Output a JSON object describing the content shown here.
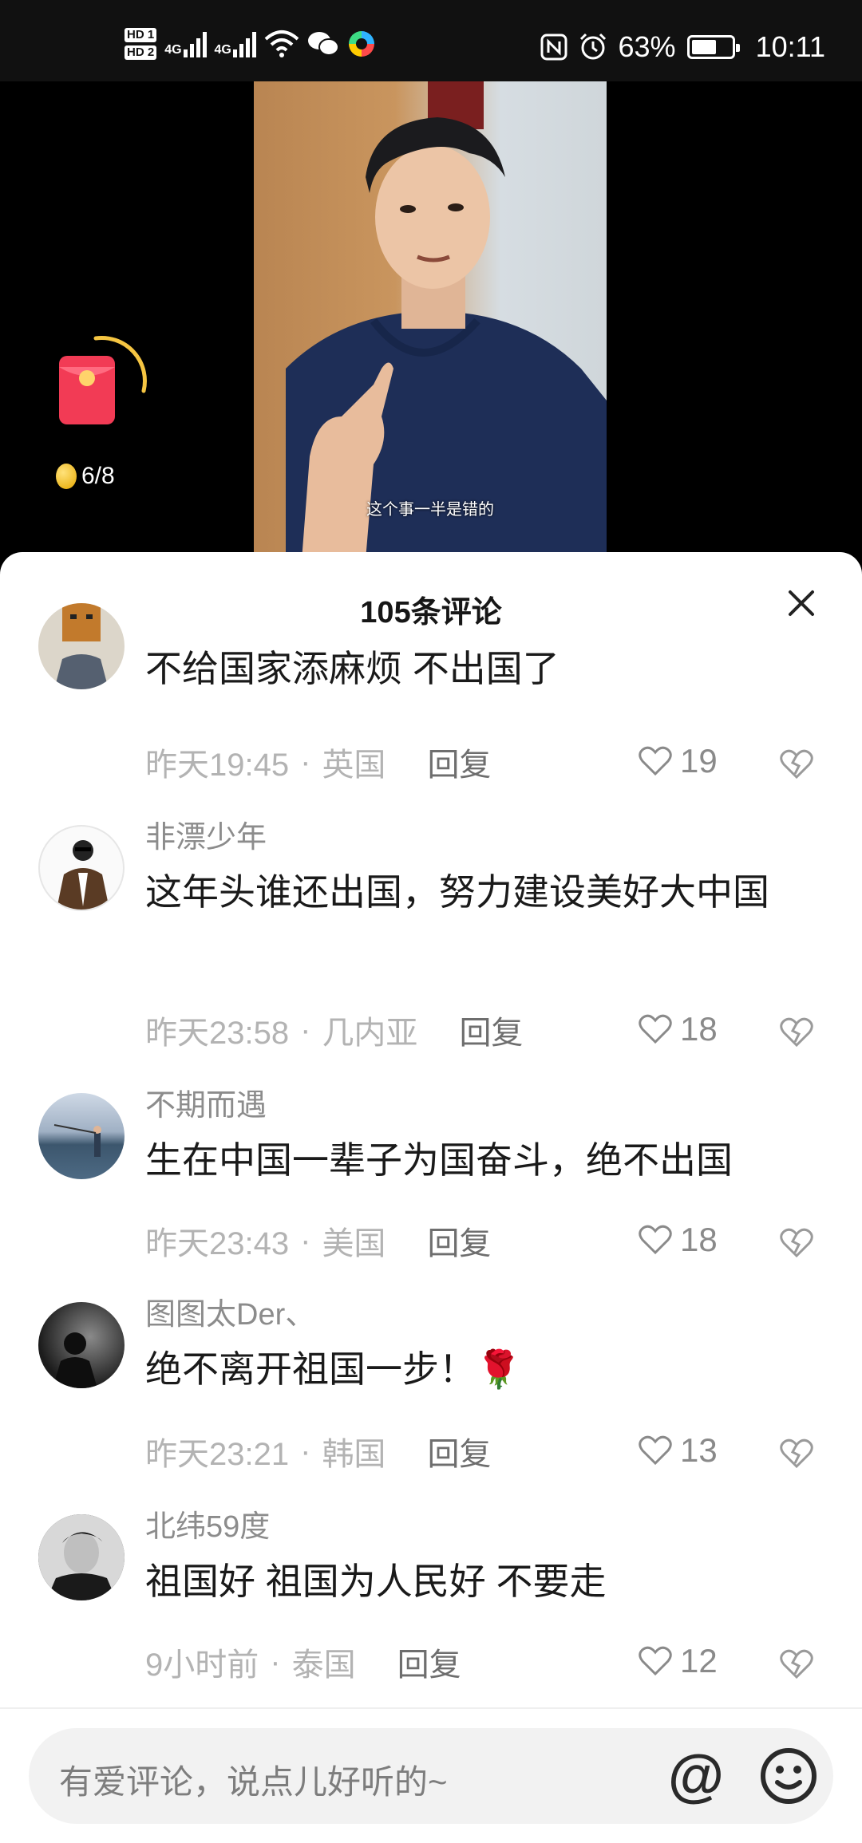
{
  "status_bar": {
    "hd1": "HD 1",
    "hd2": "HD 2",
    "net1": "4G",
    "net2": "4G",
    "battery_percent": "63%",
    "battery_level": 0.63,
    "time": "10:11"
  },
  "video": {
    "subtitle": "这个事一半是错的",
    "coin_progress": "6/8"
  },
  "comments_panel": {
    "title": "105条评论",
    "comments": [
      {
        "username": "",
        "text": "不给国家添麻烦 不出国了",
        "time": "昨天19:45",
        "location": "英国",
        "reply_label": "回复",
        "likes": "19"
      },
      {
        "username": "非漂少年",
        "text": "这年头谁还出国，努力建设美好大中国",
        "time": "昨天23:58",
        "location": "几内亚",
        "reply_label": "回复",
        "likes": "18"
      },
      {
        "username": "不期而遇",
        "text": "生在中国一辈子为国奋斗，绝不出国",
        "time": "昨天23:43",
        "location": "美国",
        "reply_label": "回复",
        "likes": "18"
      },
      {
        "username": "图图太Der、",
        "text": "绝不离开祖国一步！🌹",
        "time": "昨天23:21",
        "location": "韩国",
        "reply_label": "回复",
        "likes": "13"
      },
      {
        "username": "北纬59度",
        "text": "祖国好 祖国为人民好 不要走",
        "time": "9小时前",
        "location": "泰国",
        "reply_label": "回复",
        "likes": "12"
      }
    ]
  },
  "input": {
    "placeholder": "有爱评论，说点儿好听的~",
    "at_symbol": "@"
  },
  "colors": {
    "sheet_bg": "#ffffff",
    "text_primary": "#1a1a1a",
    "text_meta": "#b3b3b3",
    "red_packet": "#f23b55",
    "arc": "#f5c542"
  }
}
